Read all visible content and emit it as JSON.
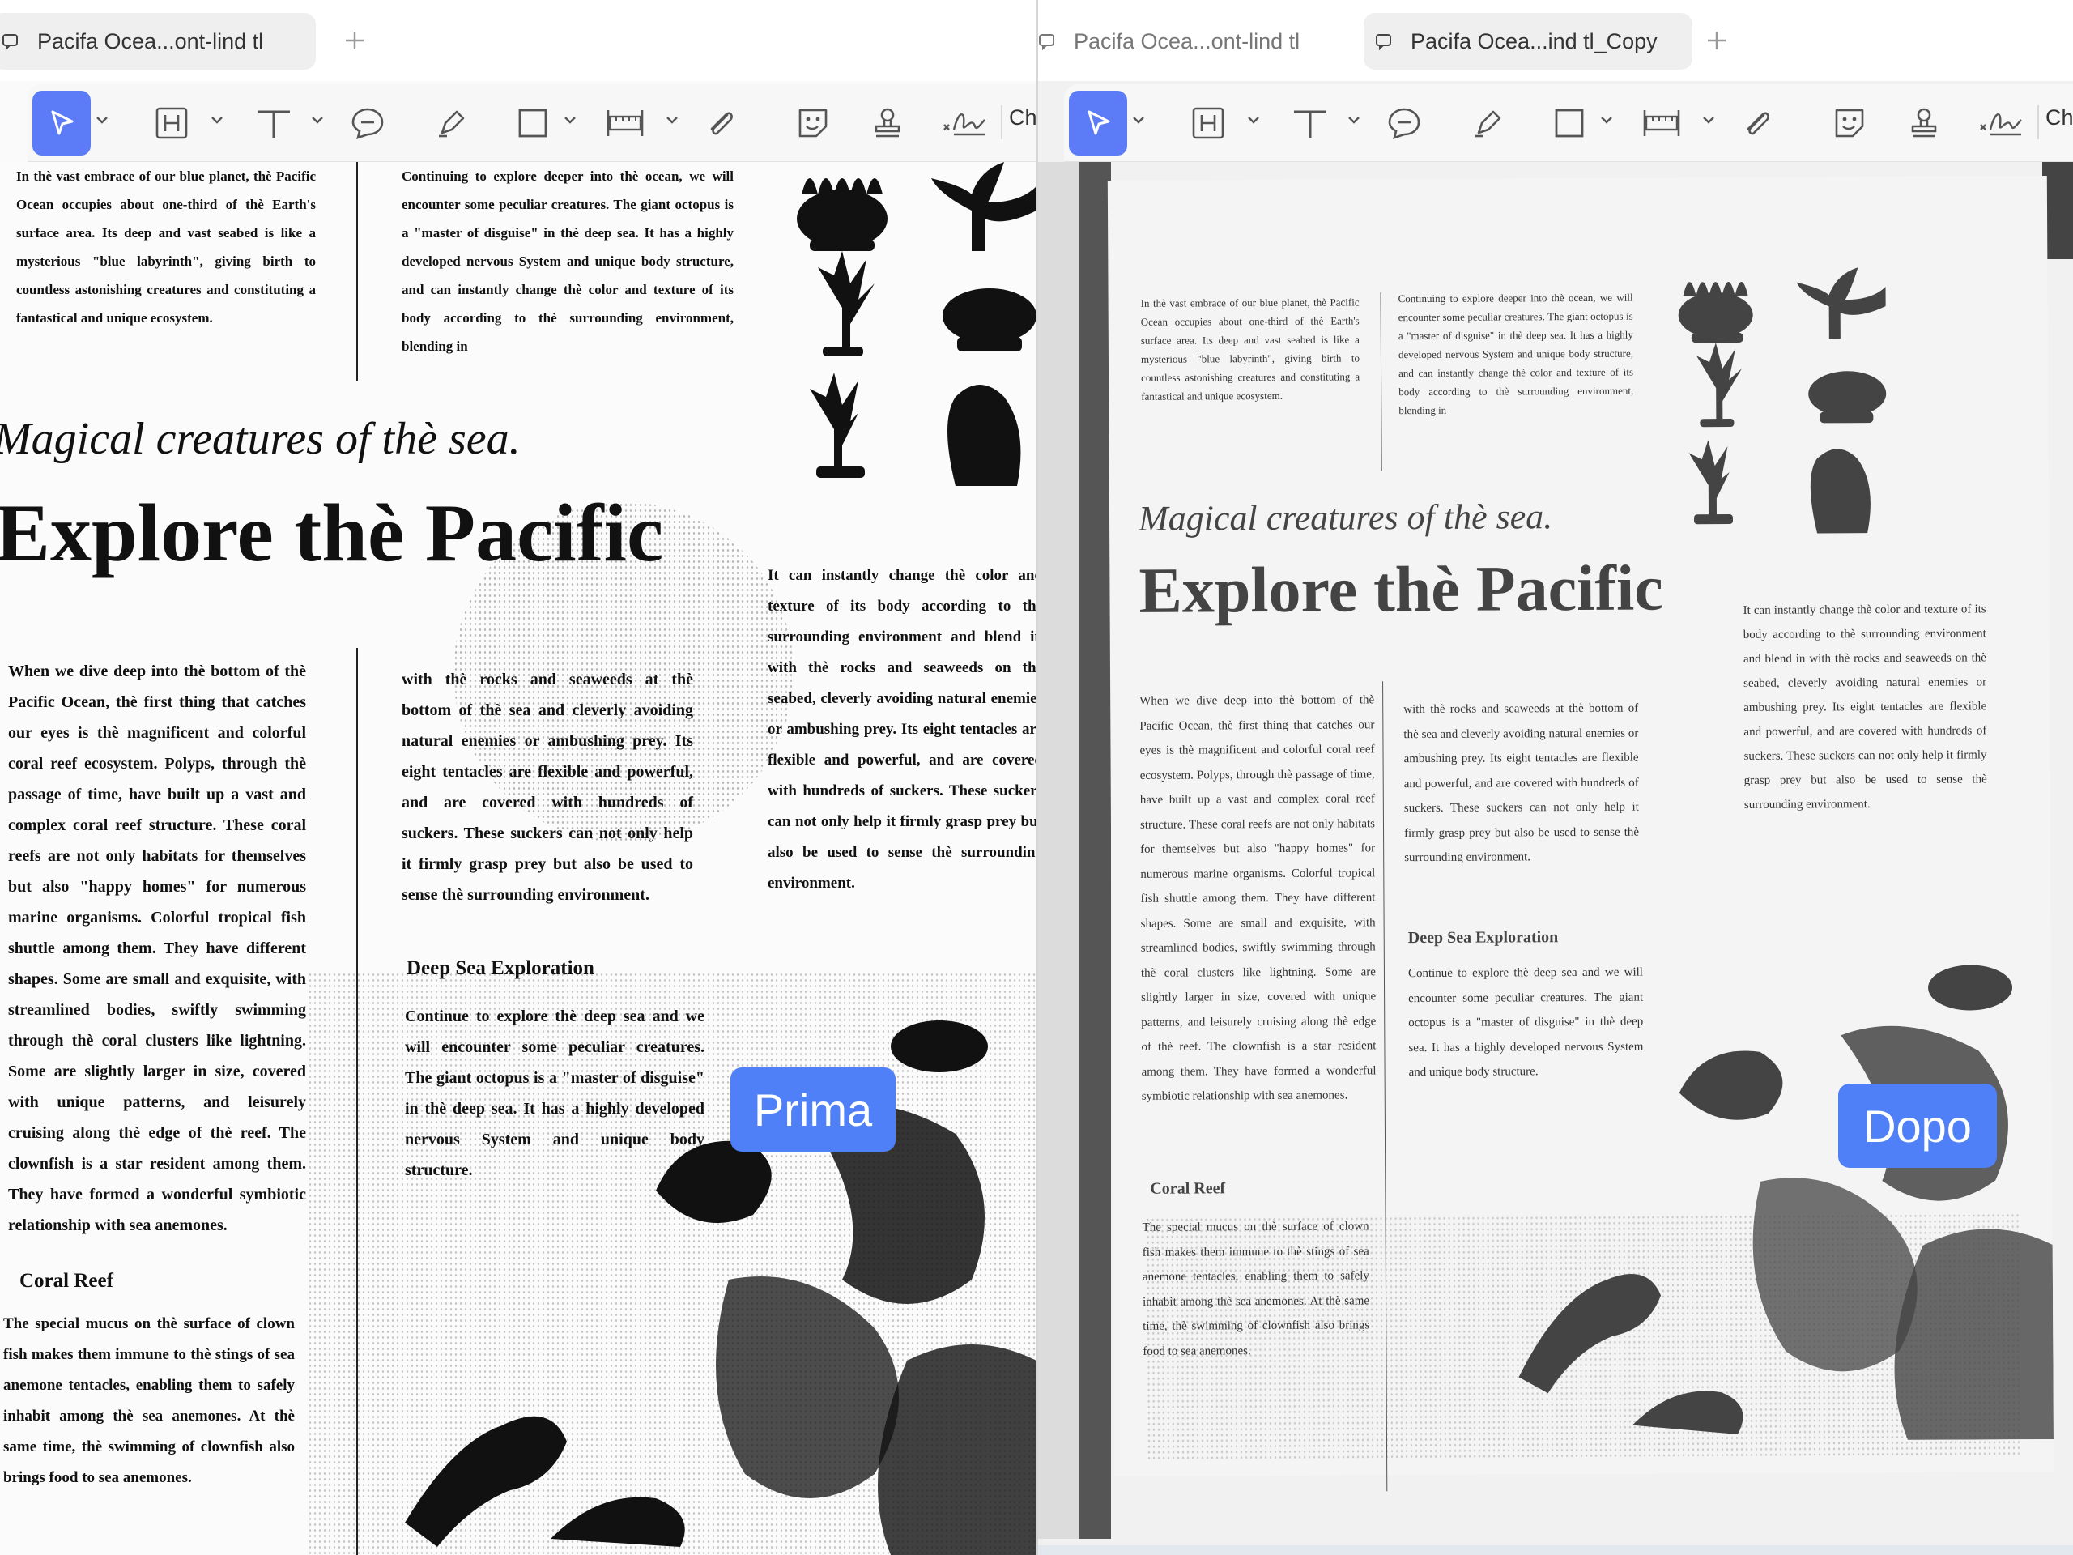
{
  "left_pane": {
    "tabs": [
      {
        "label": "Pacifa Ocea...ont-lind tl",
        "active": true
      }
    ],
    "toolbar": {
      "overflow_label": "Ch"
    },
    "document": {
      "intro_col1": "In thè vast embrace of our blue planet, thè Pacific Ocean occupies about one-third of thè Earth's surface area. Its deep and vast seabed is like a mysterious \"blue labyrinth\", giving birth to countless astonishing creatures and constituting a fantastical and unique ecosystem.",
      "intro_col2": "Continuing to explore deeper into thè ocean, we will encounter some peculiar creatures. The giant octopus is a \"master of disguise\" in thè deep sea. It has a highly developed nervous System and unique body structure, and can instantly change thè color and texture of its body according to thè surrounding environment, blending in",
      "subtitle": "Magical creatures of thè sea.",
      "title": "Explore thè Pacific",
      "col3_text": "It can instantly change thè color and texture of its body according to thè surrounding environment and blend in with thè rocks and seaweeds on thè seabed, cleverly avoiding natural enemies or ambushing prey. Its eight tentacles are flexible and powerful, and are covered with hundreds of suckers. These suckers can not only help it firmly grasp prey but also be used to sense thè surrounding environment.",
      "col1_text": "When we dive deep into thè bottom of thè Pacific Ocean, thè first thing that catches our eyes is thè magnificent and colorful coral reef ecosystem. Polyps, through thè passage of time, have built up a vast and complex coral reef structure. These coral reefs are not only habitats for themselves but also \"happy homes\" for numerous marine organisms. Colorful tropical fish shuttle among them. They have different shapes. Some are small and exquisite, with streamlined bodies, swiftly swimming through thè coral clusters like lightning. Some are slightly larger in size, covered with unique patterns, and leisurely cruising along thè edge of thè reef. The clownfish is a star resident among them. They have formed a wonderful symbiotic relationship with sea anemones.",
      "col2_text": "with thè rocks and seaweeds at thè bottom of thè sea and cleverly avoiding natural enemies or ambushing prey. Its eight tentacles are flexible and powerful, and are covered with hundreds of suckers. These suckers can not only help it firmly grasp prey but also be used to sense thè surrounding environment.",
      "deep_sea_heading": "Deep Sea Exploration",
      "deep_sea_text": "Continue to explore thè deep sea and we will encounter some peculiar creatures. The giant octopus is a \"master of disguise\" in thè deep sea. It has a highly developed nervous System and unique body structure.",
      "coral_heading": "Coral Reef",
      "coral_text": "The special mucus on thè surface of clown fish makes them immune to thè stings of sea anemone tentacles, enabling them to safely inhabit among thè sea anemones. At thè same time, thè swimming of clownfish also brings food to sea anemones."
    },
    "badge": "Prima"
  },
  "right_pane": {
    "tabs": [
      {
        "label": "Pacifa Ocea...ont-lind tl",
        "active": false
      },
      {
        "label": "Pacifa Ocea...ind tl_Copy",
        "active": true
      }
    ],
    "toolbar": {
      "overflow_label": "Chi"
    },
    "badge": "Dopo"
  },
  "colors": {
    "accent": "#5b7cf6",
    "badge": "#4f80f7"
  }
}
